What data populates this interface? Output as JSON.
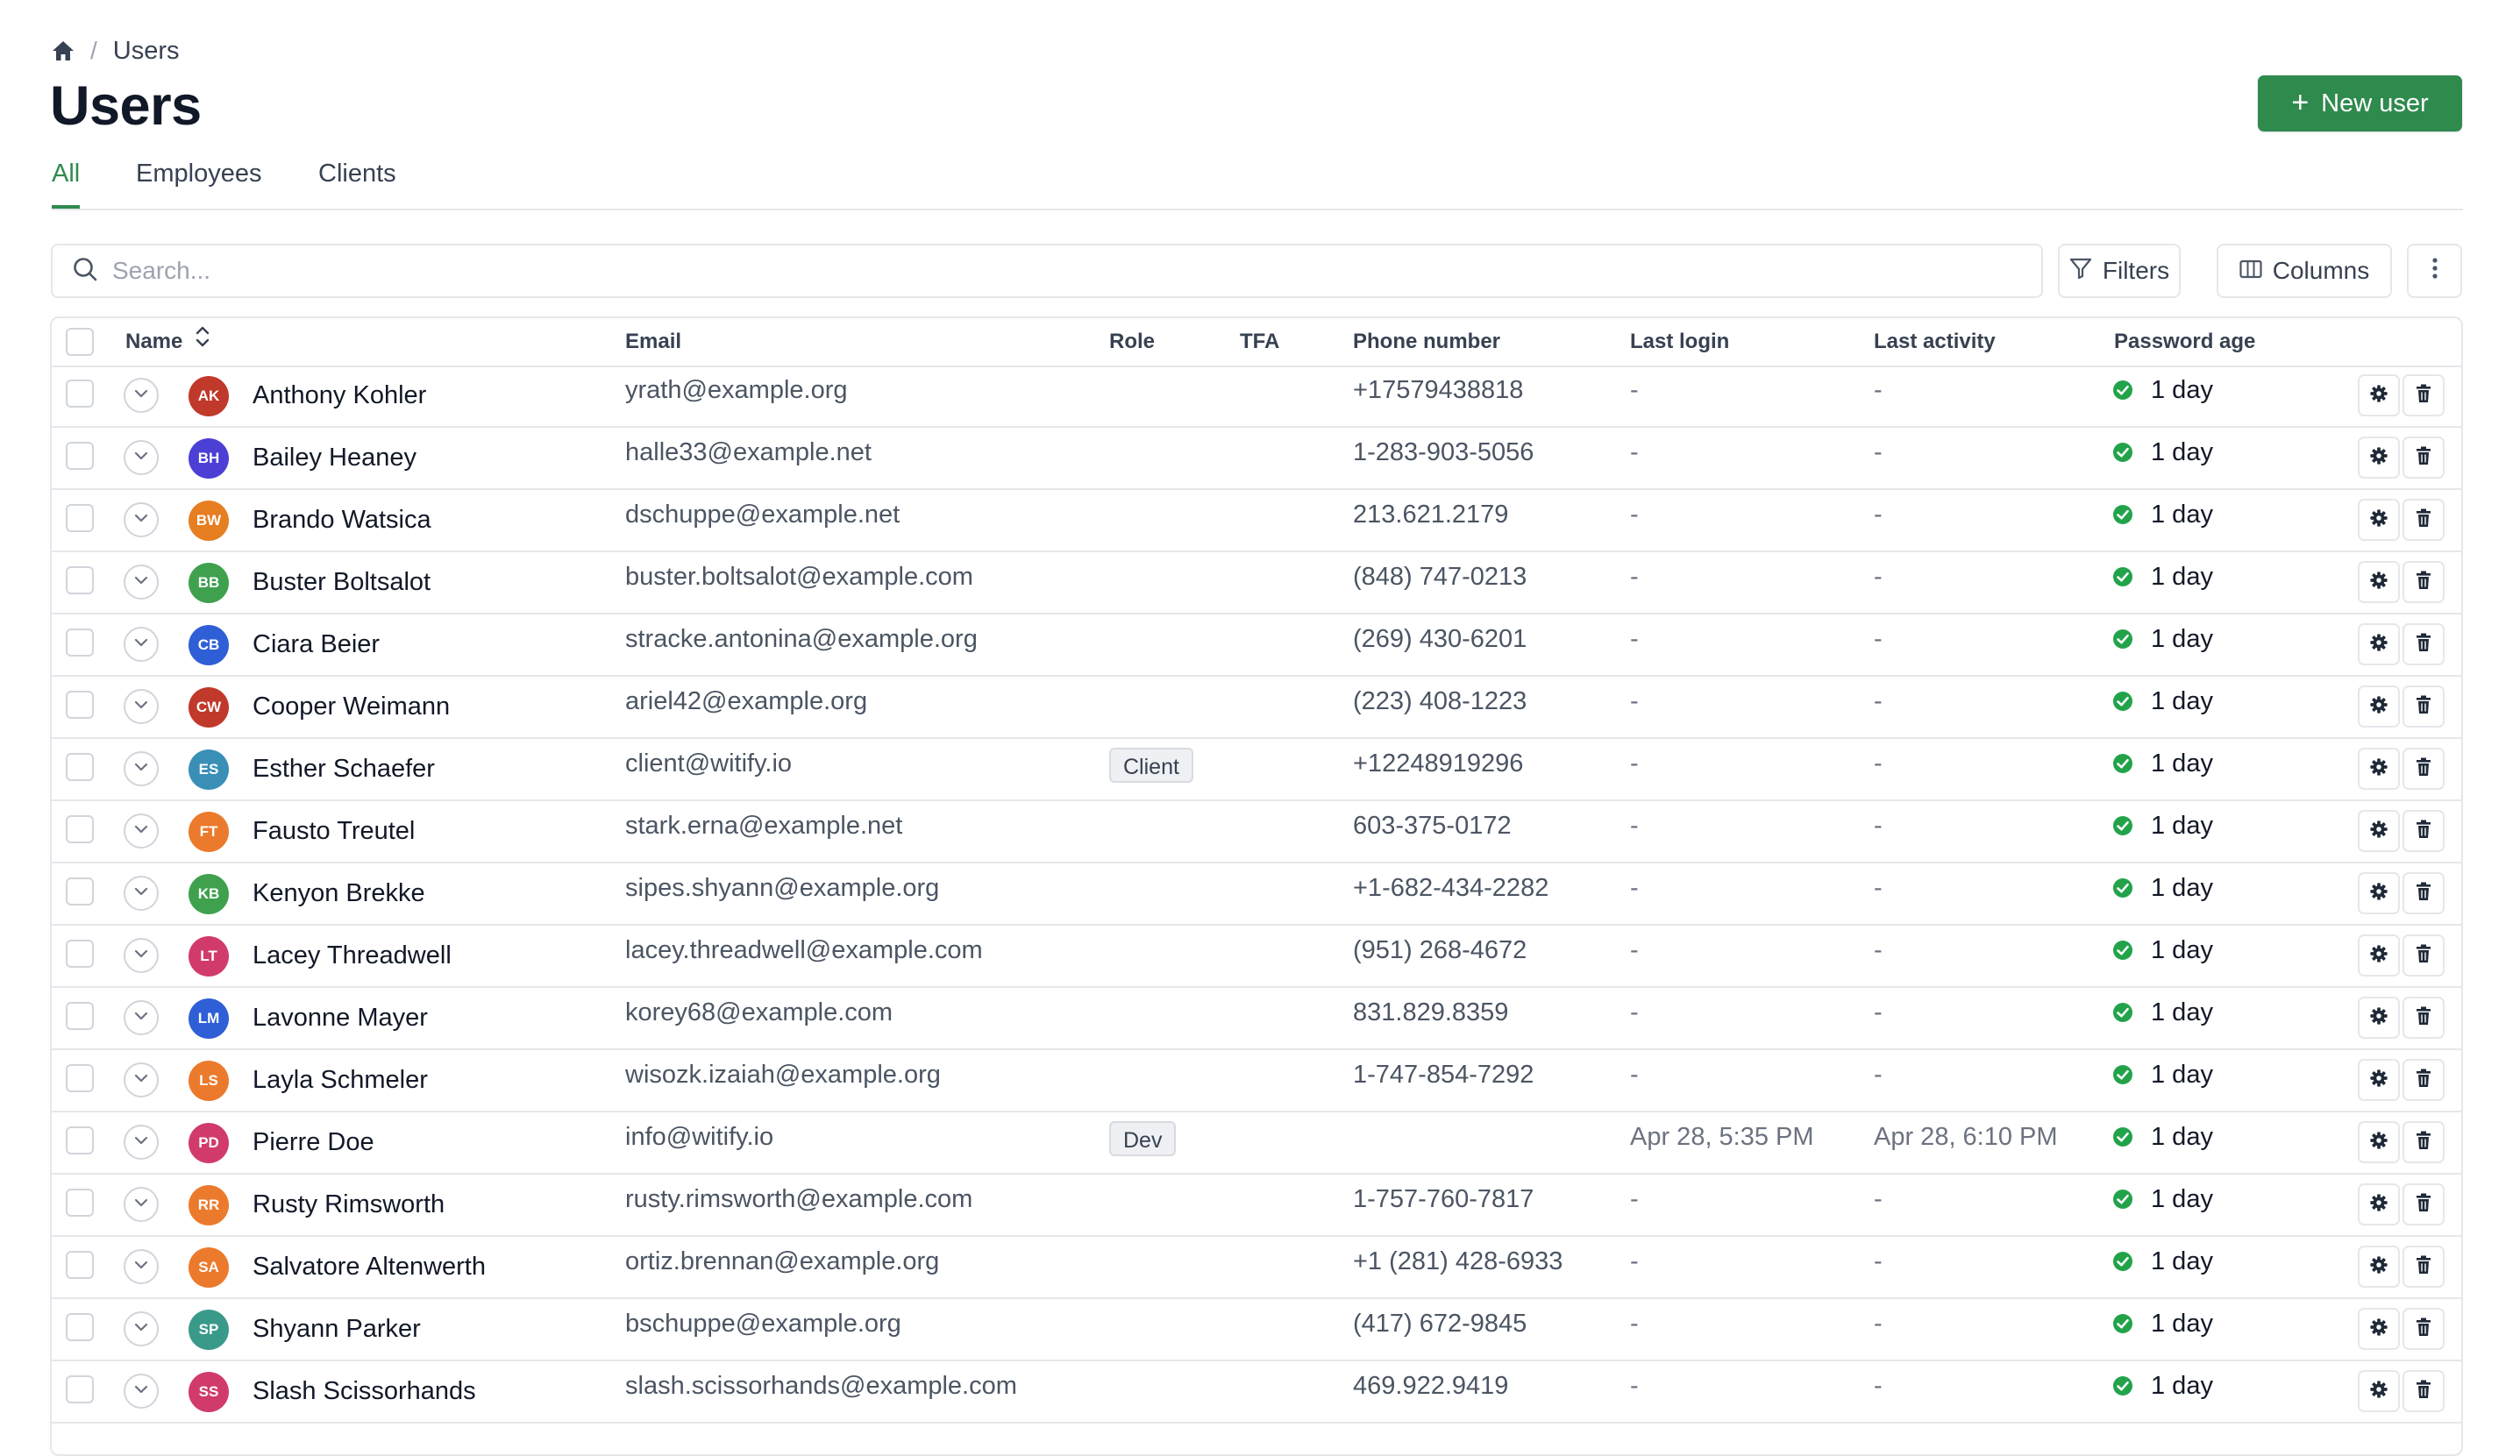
{
  "breadcrumb": {
    "current": "Users"
  },
  "page": {
    "title": "Users",
    "new_user_label": "New user"
  },
  "tabs": [
    {
      "label": "All",
      "active": true
    },
    {
      "label": "Employees",
      "active": false
    },
    {
      "label": "Clients",
      "active": false
    }
  ],
  "toolbar": {
    "search_placeholder": "Search...",
    "filters_label": "Filters",
    "columns_label": "Columns"
  },
  "table": {
    "headers": {
      "name": "Name",
      "email": "Email",
      "role": "Role",
      "tfa": "TFA",
      "phone": "Phone number",
      "last_login": "Last login",
      "last_activity": "Last activity",
      "password_age": "Password age"
    },
    "rows": [
      {
        "initials": "AK",
        "color": "#c0392b",
        "name": "Anthony Kohler",
        "email": "yrath@example.org",
        "role": "",
        "phone": "+17579438818",
        "last_login": "-",
        "last_activity": "-",
        "password_age": "1 day"
      },
      {
        "initials": "BH",
        "color": "#4b3fd6",
        "name": "Bailey Heaney",
        "email": "halle33@example.net",
        "role": "",
        "phone": "1-283-903-5056",
        "last_login": "-",
        "last_activity": "-",
        "password_age": "1 day"
      },
      {
        "initials": "BW",
        "color": "#e67e22",
        "name": "Brando Watsica",
        "email": "dschuppe@example.net",
        "role": "",
        "phone": "213.621.2179",
        "last_login": "-",
        "last_activity": "-",
        "password_age": "1 day"
      },
      {
        "initials": "BB",
        "color": "#3fa14e",
        "name": "Buster Boltsalot",
        "email": "buster.boltsalot@example.com",
        "role": "",
        "phone": "(848) 747-0213",
        "last_login": "-",
        "last_activity": "-",
        "password_age": "1 day"
      },
      {
        "initials": "CB",
        "color": "#2f5fd6",
        "name": "Ciara Beier",
        "email": "stracke.antonina@example.org",
        "role": "",
        "phone": "(269) 430-6201",
        "last_login": "-",
        "last_activity": "-",
        "password_age": "1 day"
      },
      {
        "initials": "CW",
        "color": "#c0392b",
        "name": "Cooper Weimann",
        "email": "ariel42@example.org",
        "role": "",
        "phone": "(223) 408-1223",
        "last_login": "-",
        "last_activity": "-",
        "password_age": "1 day"
      },
      {
        "initials": "ES",
        "color": "#3a8fb7",
        "name": "Esther Schaefer",
        "email": "client@witify.io",
        "role": "Client",
        "phone": "+12248919296",
        "last_login": "-",
        "last_activity": "-",
        "password_age": "1 day"
      },
      {
        "initials": "FT",
        "color": "#ec7a2c",
        "name": "Fausto Treutel",
        "email": "stark.erna@example.net",
        "role": "",
        "phone": "603-375-0172",
        "last_login": "-",
        "last_activity": "-",
        "password_age": "1 day"
      },
      {
        "initials": "KB",
        "color": "#3fa14e",
        "name": "Kenyon Brekke",
        "email": "sipes.shyann@example.org",
        "role": "",
        "phone": "+1-682-434-2282",
        "last_login": "-",
        "last_activity": "-",
        "password_age": "1 day"
      },
      {
        "initials": "LT",
        "color": "#d13b6b",
        "name": "Lacey Threadwell",
        "email": "lacey.threadwell@example.com",
        "role": "",
        "phone": "(951) 268-4672",
        "last_login": "-",
        "last_activity": "-",
        "password_age": "1 day"
      },
      {
        "initials": "LM",
        "color": "#2f5fd6",
        "name": "Lavonne Mayer",
        "email": "korey68@example.com",
        "role": "",
        "phone": "831.829.8359",
        "last_login": "-",
        "last_activity": "-",
        "password_age": "1 day"
      },
      {
        "initials": "LS",
        "color": "#ec7a2c",
        "name": "Layla Schmeler",
        "email": "wisozk.izaiah@example.org",
        "role": "",
        "phone": "1-747-854-7292",
        "last_login": "-",
        "last_activity": "-",
        "password_age": "1 day"
      },
      {
        "initials": "PD",
        "color": "#d13b6b",
        "name": "Pierre Doe",
        "email": "info@witify.io",
        "role": "Dev",
        "phone": "",
        "last_login": "Apr 28, 5:35 PM",
        "last_activity": "Apr 28, 6:10 PM",
        "password_age": "1 day"
      },
      {
        "initials": "RR",
        "color": "#ec7a2c",
        "name": "Rusty Rimsworth",
        "email": "rusty.rimsworth@example.com",
        "role": "",
        "phone": "1-757-760-7817",
        "last_login": "-",
        "last_activity": "-",
        "password_age": "1 day"
      },
      {
        "initials": "SA",
        "color": "#ec7a2c",
        "name": "Salvatore Altenwerth",
        "email": "ortiz.brennan@example.org",
        "role": "",
        "phone": "+1 (281) 428-6933",
        "last_login": "-",
        "last_activity": "-",
        "password_age": "1 day"
      },
      {
        "initials": "SP",
        "color": "#3a9a8a",
        "name": "Shyann Parker",
        "email": "bschuppe@example.org",
        "role": "",
        "phone": "(417) 672-9845",
        "last_login": "-",
        "last_activity": "-",
        "password_age": "1 day"
      },
      {
        "initials": "SS",
        "color": "#d13b6b",
        "name": "Slash Scissorhands",
        "email": "slash.scissorhands@example.com",
        "role": "",
        "phone": "469.922.9419",
        "last_login": "-",
        "last_activity": "-",
        "password_age": "1 day"
      }
    ]
  },
  "colors": {
    "accent": "#2f8a4e",
    "status_ok": "#22a34a",
    "border": "#e5e7eb"
  },
  "icons": {
    "breadcrumb_home": "home-icon",
    "search": "search-icon",
    "filters": "filter-icon",
    "columns": "columns-icon",
    "more": "more-vertical-icon",
    "sort": "sort-icon",
    "row_expand": "chevron-down-icon",
    "password_ok": "check-circle-icon",
    "row_settings": "gear-icon",
    "row_delete": "trash-icon"
  }
}
